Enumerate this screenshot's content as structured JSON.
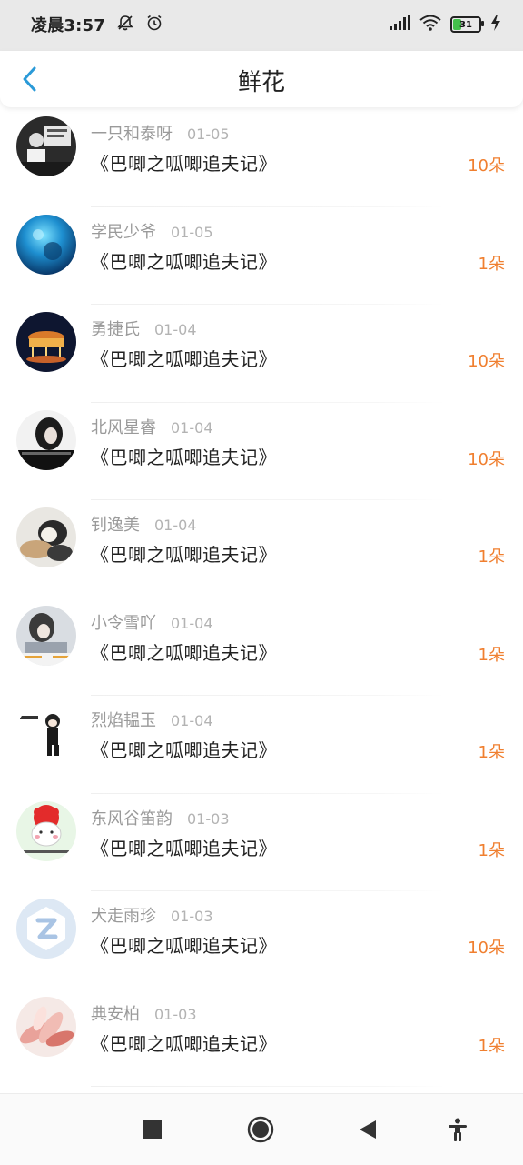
{
  "status_bar": {
    "time": "凌晨3:57",
    "battery_level": "31",
    "icons": [
      "mute-icon",
      "alarm-icon",
      "signal-icon",
      "wifi-icon",
      "battery-icon",
      "charging-icon"
    ]
  },
  "header": {
    "title": "鲜花",
    "back_icon": "chevron-left-icon",
    "accent_color": "#2a9ad8"
  },
  "list": {
    "items": [
      {
        "name": "一只和泰呀",
        "date": "01-05",
        "book": "《巴唧之呱唧追夫记》",
        "count": "10朵",
        "avatar": "photo-bw-person"
      },
      {
        "name": "学民少爷",
        "date": "01-05",
        "book": "《巴唧之呱唧追夫记》",
        "count": "1朵",
        "avatar": "photo-blue-ocean"
      },
      {
        "name": "勇捷氏",
        "date": "01-04",
        "book": "《巴唧之呱唧追夫记》",
        "count": "10朵",
        "avatar": "photo-carousel"
      },
      {
        "name": "北风星睿",
        "date": "01-04",
        "book": "《巴唧之呱唧追夫记》",
        "count": "10朵",
        "avatar": "photo-bw-girl"
      },
      {
        "name": "钊逸美",
        "date": "01-04",
        "book": "《巴唧之呱唧追夫记》",
        "count": "1朵",
        "avatar": "photo-cat"
      },
      {
        "name": "小令雪吖",
        "date": "01-04",
        "book": "《巴唧之呱唧追夫记》",
        "count": "1朵",
        "avatar": "photo-girl"
      },
      {
        "name": "烈焰韫玉",
        "date": "01-04",
        "book": "《巴唧之呱唧追夫记》",
        "count": "1朵",
        "avatar": "cartoon-figure"
      },
      {
        "name": "东风谷笛韵",
        "date": "01-03",
        "book": "《巴唧之呱唧追夫记》",
        "count": "1朵",
        "avatar": "cartoon-red-hair"
      },
      {
        "name": "犬走雨珍",
        "date": "01-03",
        "book": "《巴唧之呱唧追夫记》",
        "count": "10朵",
        "avatar": "default-z-logo"
      },
      {
        "name": "典安柏",
        "date": "01-03",
        "book": "《巴唧之呱唧追夫记》",
        "count": "1朵",
        "avatar": "photo-pink-flower"
      }
    ]
  },
  "colors": {
    "count_color": "#f07f2f",
    "name_color": "#9a9a9a",
    "status_bg": "#e9e9e9"
  },
  "nav_bar": {
    "icons": [
      "recents-square-icon",
      "home-circle-icon",
      "back-triangle-icon",
      "accessibility-icon"
    ]
  }
}
